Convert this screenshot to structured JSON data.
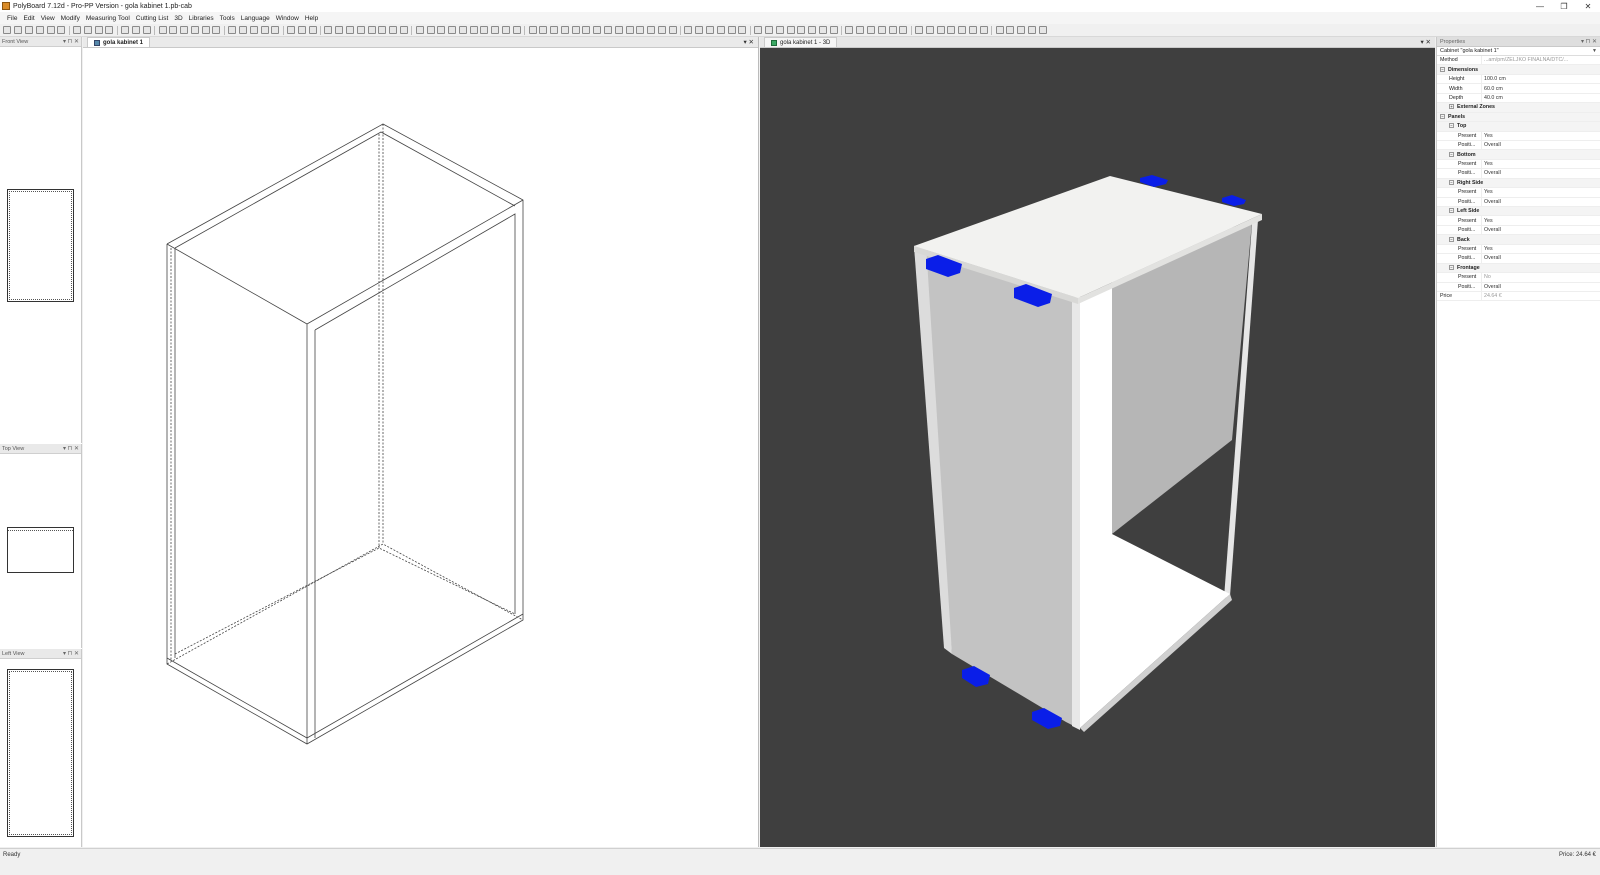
{
  "window": {
    "title": "PolyBoard 7.12d - Pro-PP Version - gola kabinet 1.pb-cab",
    "controls": [
      "—",
      "❐",
      "✕"
    ]
  },
  "menu": [
    "File",
    "Edit",
    "View",
    "Modify",
    "Measuring Tool",
    "Cutting List",
    "3D",
    "Libraries",
    "Tools",
    "Language",
    "Window",
    "Help"
  ],
  "left_panels": {
    "front_view": "Front View",
    "top_view": "Top View",
    "left_view": "Left View",
    "panel_buttons": "▾ ⊓ ✕"
  },
  "doc_tab_2d": {
    "label": "gola kabinet 1",
    "controls": "▾ ✕"
  },
  "doc_tab_3d": {
    "label": "gola kabinet 1 - 3D",
    "controls": "▾ ✕"
  },
  "properties": {
    "header": "Properties",
    "header_buttons": "▾ ⊓ ✕",
    "selector": "Cabinet \"gola kabinet 1\"",
    "rows": [
      {
        "key": "Method",
        "value": "...am/pm/ZELJKO FINALNA/DTC/...",
        "indent": 3,
        "type": "field",
        "muted": true
      },
      {
        "key": "Dimensions",
        "value": "",
        "indent": 3,
        "type": "group",
        "toggle": "−"
      },
      {
        "key": "Height",
        "value": "100.0 cm",
        "indent": 12,
        "type": "field"
      },
      {
        "key": "Width",
        "value": "60.0 cm",
        "indent": 12,
        "type": "field"
      },
      {
        "key": "Depth",
        "value": "40.0 cm",
        "indent": 12,
        "type": "field"
      },
      {
        "key": "External Zones",
        "value": "",
        "indent": 12,
        "type": "group",
        "toggle": "+"
      },
      {
        "key": "Panels",
        "value": "",
        "indent": 3,
        "type": "group",
        "toggle": "−"
      },
      {
        "key": "Top",
        "value": "",
        "indent": 12,
        "type": "group",
        "toggle": "−"
      },
      {
        "key": "Present",
        "value": "Yes",
        "indent": 21,
        "type": "field"
      },
      {
        "key": "Positi...",
        "value": "Overall",
        "indent": 21,
        "type": "field"
      },
      {
        "key": "Bottom",
        "value": "",
        "indent": 12,
        "type": "group",
        "toggle": "−"
      },
      {
        "key": "Present",
        "value": "Yes",
        "indent": 21,
        "type": "field"
      },
      {
        "key": "Positi...",
        "value": "Overall",
        "indent": 21,
        "type": "field"
      },
      {
        "key": "Right Side",
        "value": "",
        "indent": 12,
        "type": "group",
        "toggle": "−"
      },
      {
        "key": "Present",
        "value": "Yes",
        "indent": 21,
        "type": "field"
      },
      {
        "key": "Positi...",
        "value": "Overall",
        "indent": 21,
        "type": "field"
      },
      {
        "key": "Left Side",
        "value": "",
        "indent": 12,
        "type": "group",
        "toggle": "−"
      },
      {
        "key": "Present",
        "value": "Yes",
        "indent": 21,
        "type": "field"
      },
      {
        "key": "Positi...",
        "value": "Overall",
        "indent": 21,
        "type": "field"
      },
      {
        "key": "Back",
        "value": "",
        "indent": 12,
        "type": "group",
        "toggle": "−"
      },
      {
        "key": "Present",
        "value": "Yes",
        "indent": 21,
        "type": "field"
      },
      {
        "key": "Positi...",
        "value": "Overall",
        "indent": 21,
        "type": "field"
      },
      {
        "key": "Frontage",
        "value": "",
        "indent": 12,
        "type": "group",
        "toggle": "−"
      },
      {
        "key": "Present",
        "value": "No",
        "indent": 21,
        "type": "field",
        "muted": true
      },
      {
        "key": "Positi...",
        "value": "Overall",
        "indent": 21,
        "type": "field"
      },
      {
        "key": "Price",
        "value": "24.64 €",
        "indent": 3,
        "type": "field",
        "muted": true
      }
    ]
  },
  "status": {
    "left": "Ready",
    "right": "Price: 24.64 €"
  },
  "colors": {
    "viewport_bg": "#3f3f3f",
    "panel_light": "#f2f2f0",
    "panel_shade": "#c0c0c0",
    "connector": "#0a1ee8"
  }
}
